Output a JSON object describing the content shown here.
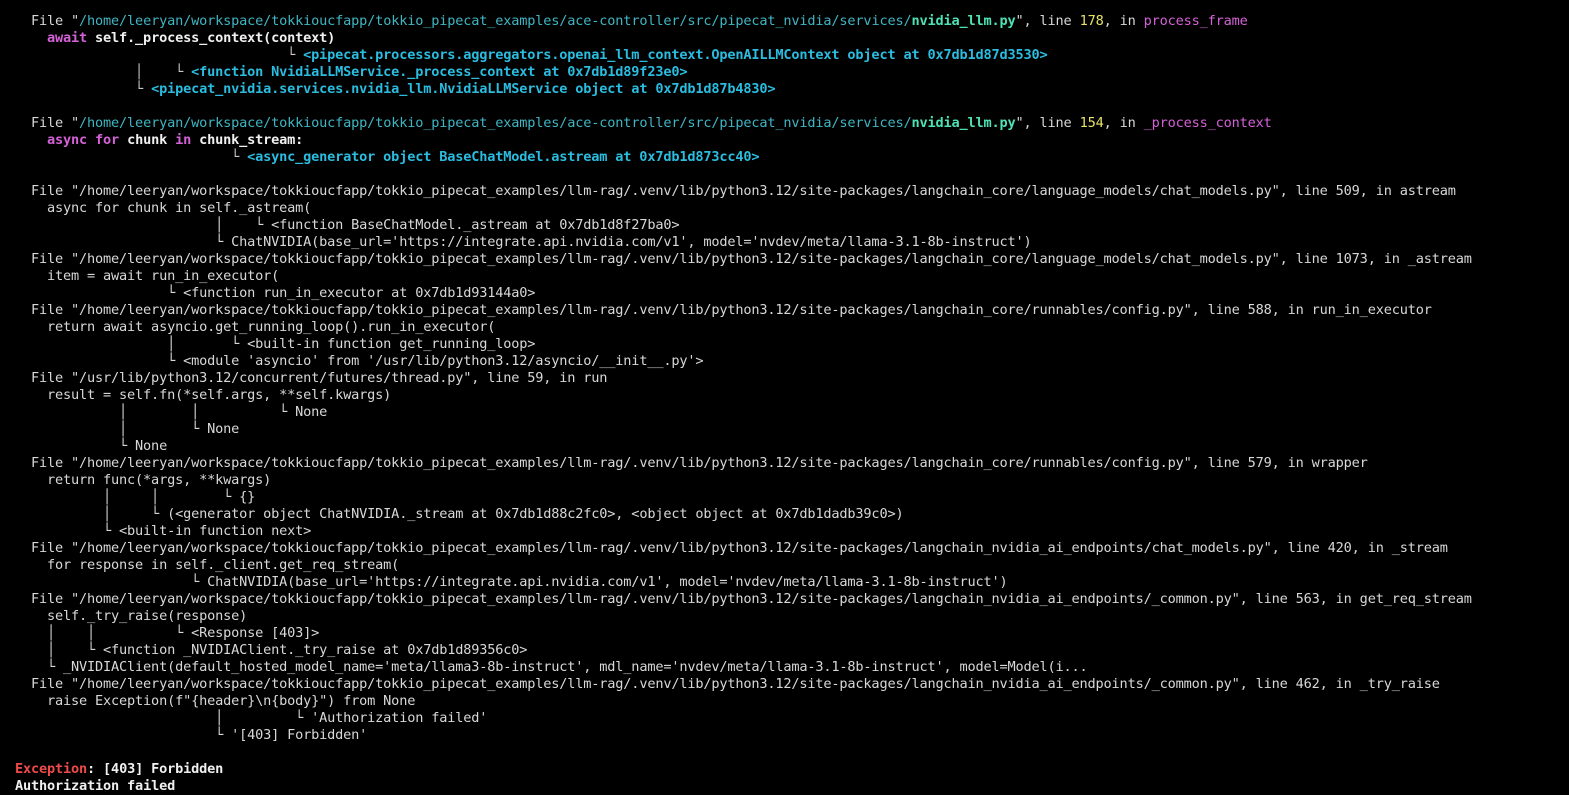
{
  "traceback": {
    "frame1": {
      "file_prefix": "File \"",
      "path": "/home/leeryan/workspace/tokkioucfapp/tokkio_pipecat_examples/ace-controller/src/pipecat_nvidia/services/",
      "file": "nvidia_llm.py",
      "mid": "\", line ",
      "line": "178",
      "in": ", in ",
      "func": "process_frame",
      "code_kw": "await",
      "code_rest": " self._process_context(context)",
      "ann1_tree": "                              └ ",
      "ann1": "<pipecat.processors.aggregators.openai_llm_context.OpenAILLMContext object at 0x7db1d87d3530>",
      "ann2_tree": "           │    └ ",
      "ann2": "<function NvidiaLLMService._process_context at 0x7db1d89f23e0>",
      "ann3_tree": "           └ ",
      "ann3": "<pipecat_nvidia.services.nvidia_llm.NvidiaLLMService object at 0x7db1d87b4830>",
      "guide": "           │    │"
    },
    "frame2": {
      "file_prefix": "File \"",
      "path": "/home/leeryan/workspace/tokkioucfapp/tokkio_pipecat_examples/ace-controller/src/pipecat_nvidia/services/",
      "file": "nvidia_llm.py",
      "mid": "\", line ",
      "line": "154",
      "in": ", in ",
      "func": "_process_context",
      "kw1": "async",
      "kw2": "for",
      "w1": " chunk ",
      "kw3": "in",
      "w2": " chunk_stream:",
      "ann1_tree": "                       └ ",
      "ann1": "<async_generator object BaseChatModel.astream at 0x7db1d873cc40>"
    },
    "plain_lines": [
      "File \"/home/leeryan/workspace/tokkioucfapp/tokkio_pipecat_examples/llm-rag/.venv/lib/python3.12/site-packages/langchain_core/language_models/chat_models.py\", line 509, in astream",
      "  async for chunk in self._astream(",
      "                       │    └ <function BaseChatModel._astream at 0x7db1d8f27ba0>",
      "                       └ ChatNVIDIA(base_url='https://integrate.api.nvidia.com/v1', model='nvdev/meta/llama-3.1-8b-instruct')",
      "File \"/home/leeryan/workspace/tokkioucfapp/tokkio_pipecat_examples/llm-rag/.venv/lib/python3.12/site-packages/langchain_core/language_models/chat_models.py\", line 1073, in _astream",
      "  item = await run_in_executor(",
      "                 └ <function run_in_executor at 0x7db1d93144a0>",
      "File \"/home/leeryan/workspace/tokkioucfapp/tokkio_pipecat_examples/llm-rag/.venv/lib/python3.12/site-packages/langchain_core/runnables/config.py\", line 588, in run_in_executor",
      "  return await asyncio.get_running_loop().run_in_executor(",
      "                 │       └ <built-in function get_running_loop>",
      "                 └ <module 'asyncio' from '/usr/lib/python3.12/asyncio/__init__.py'>",
      "File \"/usr/lib/python3.12/concurrent/futures/thread.py\", line 59, in run",
      "  result = self.fn(*self.args, **self.kwargs)",
      "           │        │          └ None",
      "           │        └ None",
      "           └ None",
      "File \"/home/leeryan/workspace/tokkioucfapp/tokkio_pipecat_examples/llm-rag/.venv/lib/python3.12/site-packages/langchain_core/runnables/config.py\", line 579, in wrapper",
      "  return func(*args, **kwargs)",
      "         │     │        └ {}",
      "         │     └ (<generator object ChatNVIDIA._stream at 0x7db1d88c2fc0>, <object object at 0x7db1dadb39c0>)",
      "         └ <built-in function next>",
      "File \"/home/leeryan/workspace/tokkioucfapp/tokkio_pipecat_examples/llm-rag/.venv/lib/python3.12/site-packages/langchain_nvidia_ai_endpoints/chat_models.py\", line 420, in _stream",
      "  for response in self._client.get_req_stream(",
      "                    └ ChatNVIDIA(base_url='https://integrate.api.nvidia.com/v1', model='nvdev/meta/llama-3.1-8b-instruct')",
      "File \"/home/leeryan/workspace/tokkioucfapp/tokkio_pipecat_examples/llm-rag/.venv/lib/python3.12/site-packages/langchain_nvidia_ai_endpoints/_common.py\", line 563, in get_req_stream",
      "  self._try_raise(response)",
      "  │    │          └ <Response [403]>",
      "  │    └ <function _NVIDIAClient._try_raise at 0x7db1d89356c0>",
      "  └ _NVIDIAClient(default_hosted_model_name='meta/llama3-8b-instruct', mdl_name='nvdev/meta/llama-3.1-8b-instruct', model=Model(i...",
      "File \"/home/leeryan/workspace/tokkioucfapp/tokkio_pipecat_examples/llm-rag/.venv/lib/python3.12/site-packages/langchain_nvidia_ai_endpoints/_common.py\", line 462, in _try_raise",
      "  raise Exception(f\"{header}\\n{body}\") from None",
      "                       │         └ 'Authorization failed'",
      "                       └ '[403] Forbidden'"
    ],
    "exception": {
      "name": "Exception",
      "rest": ": [403] Forbidden",
      "detail": "Authorization failed"
    }
  },
  "colors": {
    "background": "#000000",
    "path": "#3fb6c3",
    "file": "#4ee1b4",
    "line_number": "#e7e36b",
    "function": "#d561d8",
    "object": "#2bbde0",
    "exception": "#f04a4a"
  }
}
